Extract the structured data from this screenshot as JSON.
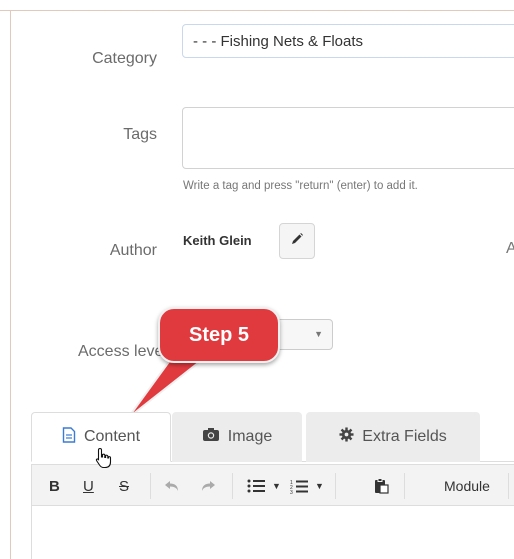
{
  "form": {
    "category_label": "Category",
    "category_value": "- - - Fishing Nets & Floats",
    "tags_label": "Tags",
    "tags_hint": "Write a tag and press \"return\" (enter) to add it.",
    "author_label": "Author",
    "author_name": "Keith Glein",
    "truncated_char": "A",
    "access_label": "Access leve"
  },
  "callout": {
    "text": "Step 5"
  },
  "tabs": [
    {
      "label": "Content",
      "icon": "document-icon",
      "active": true
    },
    {
      "label": "Image",
      "icon": "camera-icon",
      "active": false
    },
    {
      "label": "Extra Fields",
      "icon": "gear-icon",
      "active": false
    }
  ],
  "toolbar": {
    "bold": "B",
    "underline": "U",
    "strike": "S",
    "module_label": "Module"
  },
  "colors": {
    "callout": "#e03a3f",
    "select_border": "#c9d8ec",
    "frame": "#e2c9bb"
  }
}
